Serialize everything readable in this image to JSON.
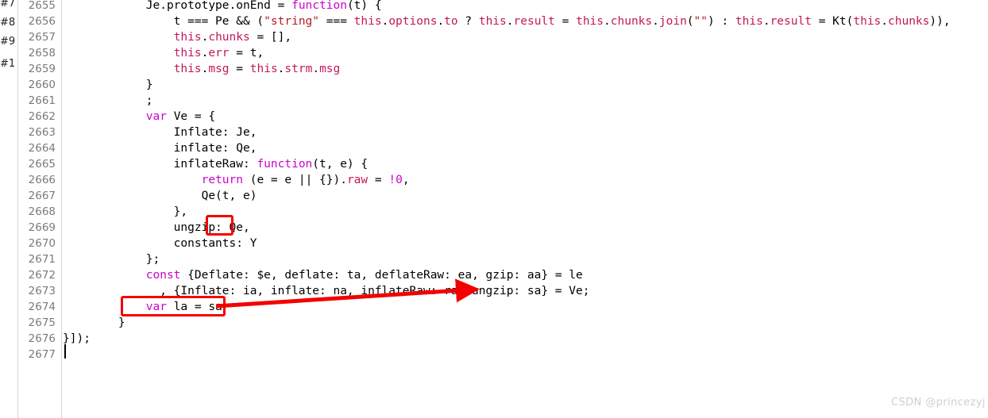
{
  "editor": {
    "background_color": "#ffffff",
    "gutter_border_color": "#d6d6d6",
    "line_number_color": "#7a7a7a",
    "text_color": "#000000",
    "keyword_color": "#cc00cc",
    "member_color": "#c2185b",
    "string_color": "#b71c1c",
    "annotation_color": "#f40000",
    "first_line_number": 2655,
    "last_line_number": 2677
  },
  "markers": [
    {
      "label": "#7"
    },
    {
      "label": "#8"
    },
    {
      "label": "#9"
    },
    {
      "label": "#1"
    }
  ],
  "line_numbers": [
    "2655",
    "2656",
    "2657",
    "2658",
    "2659",
    "2660",
    "2661",
    "2662",
    "2663",
    "2664",
    "2665",
    "2666",
    "2667",
    "2668",
    "2669",
    "2670",
    "2671",
    "2672",
    "2673",
    "2674",
    "2675",
    "2676",
    "2677"
  ],
  "code_lines": [
    {
      "n": "2655",
      "text": "            Je.prototype.onEnd = function(t) {"
    },
    {
      "n": "2656",
      "text": "                t === Pe && (\"string\" === this.options.to ? this.result = this.chunks.join(\"\") : this.result = Kt(this.chunks)),"
    },
    {
      "n": "2657",
      "text": "                this.chunks = [],"
    },
    {
      "n": "2658",
      "text": "                this.err = t,"
    },
    {
      "n": "2659",
      "text": "                this.msg = this.strm.msg"
    },
    {
      "n": "2660",
      "text": "            }"
    },
    {
      "n": "2661",
      "text": "            ;"
    },
    {
      "n": "2662",
      "text": "            var Ve = {"
    },
    {
      "n": "2663",
      "text": "                Inflate: Je,"
    },
    {
      "n": "2664",
      "text": "                inflate: Qe,"
    },
    {
      "n": "2665",
      "text": "                inflateRaw: function(t, e) {"
    },
    {
      "n": "2666",
      "text": "                    return (e = e || {}).raw = !0,"
    },
    {
      "n": "2667",
      "text": "                    Qe(t, e)"
    },
    {
      "n": "2668",
      "text": "                },"
    },
    {
      "n": "2669",
      "text": "                ungzip: Qe,"
    },
    {
      "n": "2670",
      "text": "                constants: Y"
    },
    {
      "n": "2671",
      "text": "            };"
    },
    {
      "n": "2672",
      "text": "            const {Deflate: $e, deflate: ta, deflateRaw: ea, gzip: aa} = le"
    },
    {
      "n": "2673",
      "text": "              , {Inflate: ia, inflate: na, inflateRaw: ra, ungzip: sa} = Ve;"
    },
    {
      "n": "2674",
      "text": "            var la = sa"
    },
    {
      "n": "2675",
      "text": "        }"
    },
    {
      "n": "2676",
      "text": "}]);"
    },
    {
      "n": "2677",
      "text": ""
    }
  ],
  "annotations": {
    "highlight_box_ungzip_value": {
      "label": "Qe,"
    },
    "highlight_box_var_la": {
      "label": "var la = sa"
    },
    "arrow": {
      "from_label": "var la = sa",
      "to_label": "ungzip: sa"
    }
  },
  "caret": {
    "line": "2677",
    "visible": true
  },
  "watermark": {
    "text": "CSDN @princezyj"
  }
}
